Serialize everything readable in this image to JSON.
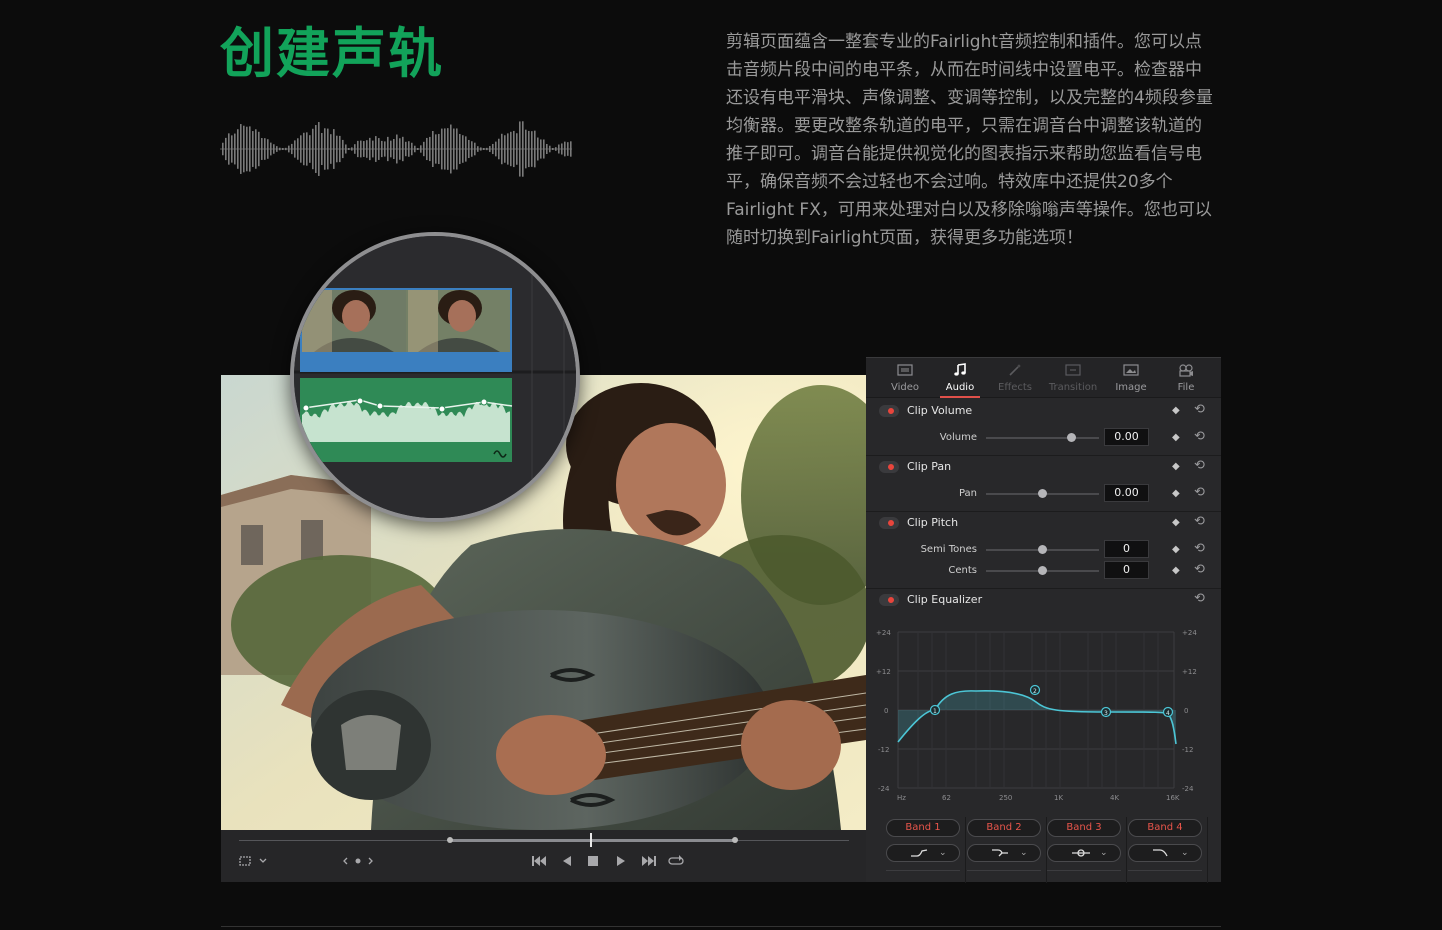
{
  "heading": {
    "title": "创建声轨"
  },
  "description": "剪辑页面蕴含一整套专业的Fairlight音频控制和插件。您可以点击音频片段中间的电平条，从而在时间线中设置电平。检查器中还设有电平滑块、声像调整、变调等控制，以及完整的4频段参量均衡器。要更改整条轨道的电平，只需在调音台中调整该轨道的推子即可。调音台能提供视觉化的图表指示来帮助您监看信号电平，确保音频不会过轻也不会过响。特效库中还提供20多个Fairlight FX，可用来处理对白以及移除嗡嗡声等操作。您也可以随时切换到Fairlight页面，获得更多功能选项！",
  "colors": {
    "accent": "#12a35a",
    "clip_blue": "#3b7fc0",
    "clip_green": "#2f8a56",
    "eq_curve": "#4cc6d6",
    "band_red": "#e8554b",
    "active_tab": "#ffffff"
  },
  "inspector": {
    "tabs": [
      {
        "label": "Video",
        "icon": "video-icon"
      },
      {
        "label": "Audio",
        "icon": "music-note-icon"
      },
      {
        "label": "Effects",
        "icon": "magic-wand-icon"
      },
      {
        "label": "Transition",
        "icon": "transition-icon"
      },
      {
        "label": "Image",
        "icon": "image-icon"
      },
      {
        "label": "File",
        "icon": "film-reel-icon"
      }
    ],
    "active_tab": "Audio",
    "clip_volume": {
      "title": "Clip Volume",
      "param_label": "Volume",
      "value": "0.00",
      "slider_level": 0.76
    },
    "clip_pan": {
      "title": "Clip Pan",
      "param_label": "Pan",
      "value": "0.00",
      "slider_level": 0.5
    },
    "clip_pitch": {
      "title": "Clip Pitch",
      "semi_tones_label": "Semi Tones",
      "semi_tones_value": "0",
      "semi_tones_level": 0.5,
      "cents_label": "Cents",
      "cents_value": "0",
      "cents_level": 0.5
    },
    "clip_equalizer": {
      "title": "Clip Equalizer",
      "y_ticks": [
        "+24",
        "+12",
        "0",
        "-12",
        "-24"
      ],
      "x_ticks": [
        "Hz",
        "62",
        "250",
        "1K",
        "4K",
        "16K"
      ],
      "node_labels": [
        "1",
        "2",
        "3",
        "4"
      ]
    },
    "bands": [
      {
        "label": "Band 1",
        "shape": "low-shelf-icon"
      },
      {
        "label": "Band 2",
        "shape": "high-shelf-bell-icon"
      },
      {
        "label": "Band 3",
        "shape": "bell-icon"
      },
      {
        "label": "Band 4",
        "shape": "high-cut-icon"
      }
    ]
  },
  "transport": {
    "icons": [
      "crop-icon",
      "chevron-down-icon",
      "prev-clip-icon",
      "jump-start-icon",
      "play-reverse-icon",
      "stop-icon",
      "play-icon",
      "jump-end-icon",
      "loop-icon"
    ]
  }
}
